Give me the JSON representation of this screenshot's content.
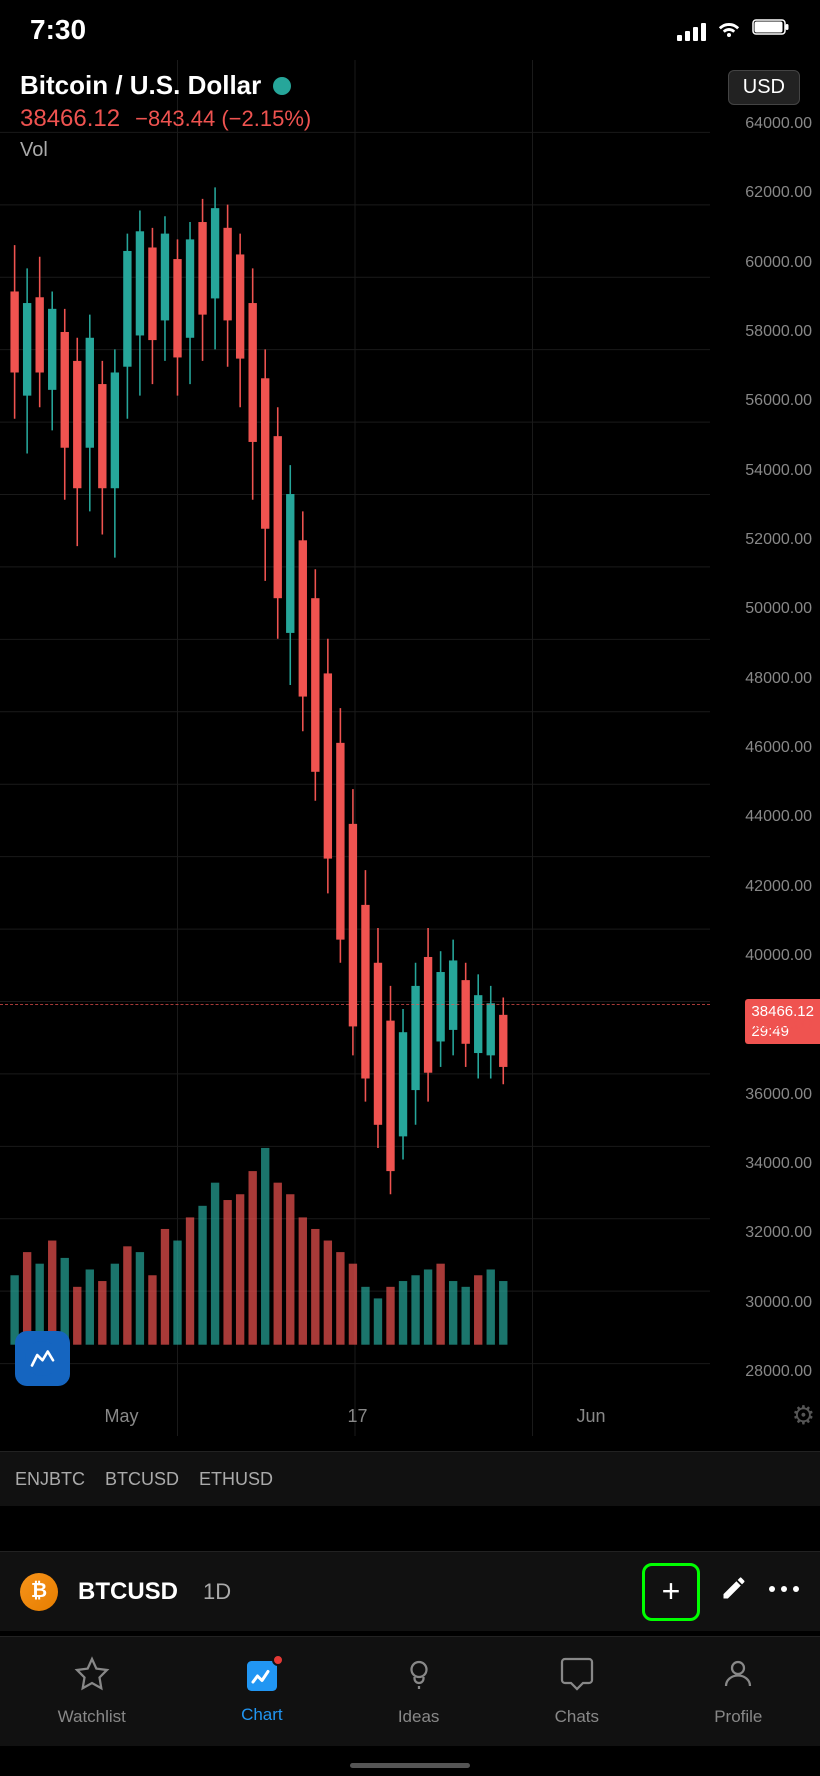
{
  "statusBar": {
    "time": "7:30",
    "signalBars": [
      4,
      8,
      12,
      16,
      20
    ],
    "battery": "🔋"
  },
  "chartHeader": {
    "pairName": "Bitcoin / U.S. Dollar",
    "liveIndicator": "live",
    "currency": "USD",
    "currentPrice": "38466.12",
    "priceChange": "−843.44 (−2.15%)",
    "volLabel": "Vol"
  },
  "priceTag": {
    "price": "38466.12",
    "time": "29:49"
  },
  "yAxis": {
    "labels": [
      "64000.00",
      "62000.00",
      "60000.00",
      "58000.00",
      "56000.00",
      "54000.00",
      "52000.00",
      "50000.00",
      "48000.00",
      "46000.00",
      "44000.00",
      "42000.00",
      "40000.00",
      "38000.00",
      "36000.00",
      "34000.00",
      "32000.00",
      "30000.00",
      "28000.00"
    ]
  },
  "xAxis": {
    "labels": [
      "May",
      "17",
      "Jun"
    ]
  },
  "tickerBar": {
    "items": [
      "ENJBTC",
      "BTCUSD",
      "ETHUSD"
    ]
  },
  "bottomToolbar": {
    "logo": "₿",
    "symbol": "BTCUSD",
    "timeframe": "1D",
    "addLabel": "+",
    "pencilLabel": "✏",
    "moreLabel": "•••"
  },
  "bottomNav": {
    "items": [
      {
        "id": "watchlist",
        "label": "Watchlist",
        "icon": "☆",
        "active": false,
        "badge": false
      },
      {
        "id": "chart",
        "label": "Chart",
        "icon": "📈",
        "active": true,
        "badge": true
      },
      {
        "id": "ideas",
        "label": "Ideas",
        "icon": "💡",
        "active": false,
        "badge": false
      },
      {
        "id": "chats",
        "label": "Chats",
        "icon": "💬",
        "active": false,
        "badge": false
      },
      {
        "id": "profile",
        "label": "Profile",
        "icon": "😊",
        "active": false,
        "badge": false
      }
    ]
  },
  "colors": {
    "bullish": "#26a69a",
    "bearish": "#ef5350",
    "background": "#000000",
    "grid": "#1a1a1a",
    "text": "#888888",
    "accent": "#2196f3",
    "addBorder": "#00ff00"
  }
}
